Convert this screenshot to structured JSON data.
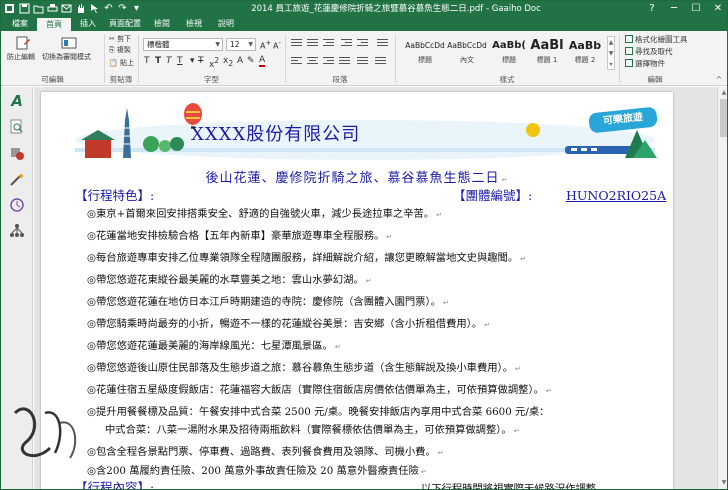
{
  "titlebar": {
    "title": "2014 員工旅遊_花蓮慶修院折騎之旅暨慕谷慕魚生態二日.pdf - Gaaiho Doc"
  },
  "menu_tabs": [
    "檔案",
    "首頁",
    "插入",
    "頁面配置",
    "檢閱",
    "檢視",
    "說明"
  ],
  "ribbon": {
    "groups": {
      "convert": "可編輯",
      "clipboard": "剪貼簿",
      "font": "字型",
      "paragraph": "段落",
      "styles": "樣式",
      "editing": "編輯"
    },
    "buttons": {
      "prevent_edit": "防止編輯",
      "switch_read": "切換為審閱模式",
      "cut": "剪下",
      "copy": "複製",
      "paste": "貼上"
    },
    "font_name": "標楷體",
    "font_size": "12",
    "styles": [
      {
        "sample": "AaBbCcDd",
        "name": "標題"
      },
      {
        "sample": "AaBbCcDd",
        "name": "內文"
      },
      {
        "sample": "AaBb(",
        "name": "標題"
      },
      {
        "sample": "AaBl",
        "name": "標題 1"
      },
      {
        "sample": "AaBb",
        "name": "標題 2"
      }
    ],
    "edit_buttons": [
      "格式化繪圖工具",
      "尋找及取代",
      "選擇物件"
    ]
  },
  "colors": {
    "brand": "#217346",
    "heading_blue": "#1b1ba8"
  },
  "document": {
    "company": "XXXX股份有限公司",
    "subtitle": "後山花蓮、慶修院折騎之旅、慕谷慕魚生態二日",
    "features_heading": "【行程特色】:",
    "group_code_label": "【團體編號】:",
    "group_code": "HUNO2RIO25A",
    "lines": [
      "◎東京+首爾來回安排搭乘安全、舒適的自強號火車，減少長途拉車之辛苦。",
      "◎花蓮當地安排檢驗合格【五年內新車】豪華旅遊專車全程服務。",
      "◎每台旅遊專車安排乙位專業領隊全程隨團服務，詳細解說介紹，讓您更瞭解當地文史與趣聞。",
      "◎帶您悠遊花東縱谷最美麗的水草豐美之地：雲山水夢幻湖。",
      "◎帶您悠遊花蓮在地仿日本江戶時期建造的寺院：慶修院（含團體入園門票）。",
      "◎帶您騎乘時尚最夯的小折，暢遊不一樣的花蓮縱谷美景：吉安鄉（含小折租借費用）。",
      "◎帶您悠遊花蓮最美麗的海岸線風光：七星潭風景區。",
      "◎帶您悠遊後山原住民部落及生態步道之旅：慕谷慕魚生態步道（含生態解說及換小車費用）。",
      "◎花蓮住宿五星級度假飯店：花蓮福容大飯店（實際住宿飯店房價依估價單為主，可依預算做調整）。",
      "◎提升用餐餐標及品質：午餐安排中式合菜 2500 元/桌。晚餐安排飯店內享用中式合菜 6600 元/桌：",
      "中式合菜：八菜一湯附水果及招待兩瓶飲料（實際餐標依估價單為主，可依預算做調整）。",
      "◎包含全程各景點門票、停車費、過路費、表列餐食費用及領隊、司機小費。",
      "◎含200 萬履約責任險、200 萬意外事故責任險及 20 萬意外醫療責任險"
    ],
    "itinerary_heading": "【行程內容】:",
    "itinerary_note": "以下行程時間將視實際天候路況作調整"
  },
  "banner_badge": "可樂旅遊",
  "icons": {
    "left_tools": [
      "text-tool-icon",
      "zoom-page-icon",
      "shape-tool-icon",
      "magic-wand-icon",
      "history-icon",
      "hierarchy-icon"
    ]
  }
}
